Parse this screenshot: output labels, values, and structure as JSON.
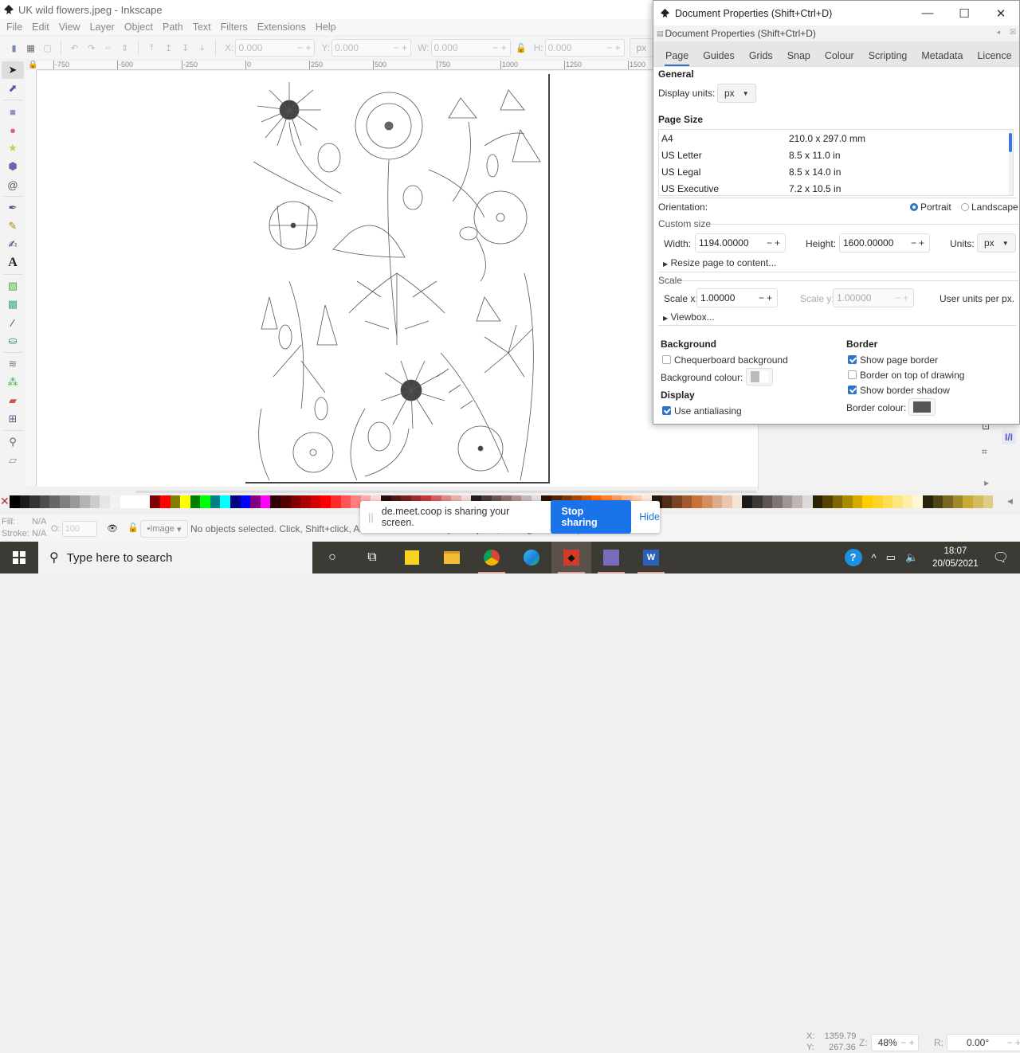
{
  "app": {
    "window_title": "UK wild flowers.jpeg - Inkscape",
    "menu": [
      "File",
      "Edit",
      "View",
      "Layer",
      "Object",
      "Path",
      "Text",
      "Filters",
      "Extensions",
      "Help"
    ],
    "toolbar": {
      "x_label": "X:",
      "x_value": "0.000",
      "y_label": "Y:",
      "y_value": "0.000",
      "w_label": "W:",
      "w_value": "0.000",
      "h_label": "H:",
      "h_value": "0.000",
      "units": "px"
    },
    "ruler_labels": [
      "-750",
      "-500",
      "-250",
      "0",
      "250",
      "500",
      "750",
      "1000",
      "1250",
      "1500"
    ],
    "tools": [
      "selector-tool",
      "node-tool",
      "rectangle-tool",
      "ellipse-tool",
      "star-tool",
      "3d-box-tool",
      "spiral-tool",
      "bezier-tool",
      "pencil-tool",
      "calligraphy-tool",
      "text-tool",
      "gradient-tool",
      "mesh-tool",
      "dropper-tool",
      "paint-bucket-tool",
      "tweak-tool",
      "spray-tool",
      "eraser-tool",
      "connector-tool",
      "zoom-tool",
      "measure-tool"
    ],
    "palette": [
      "#000000",
      "#1a1a1a",
      "#333333",
      "#4d4d4d",
      "#666666",
      "#808080",
      "#999999",
      "#b3b3b3",
      "#cccccc",
      "#e6e6e6",
      "#f2f2f2",
      "#ffffff",
      "#ffffff",
      "#ffffff",
      "#800000",
      "#ff0000",
      "#808000",
      "#ffff00",
      "#008000",
      "#00ff00",
      "#008080",
      "#00ffff",
      "#000080",
      "#0000ff",
      "#800080",
      "#ff00ff",
      "#2b0000",
      "#550000",
      "#800000",
      "#aa0000",
      "#d40000",
      "#ff0000",
      "#ff2a2a",
      "#ff5555",
      "#ff8080",
      "#ffaaaa",
      "#ffd5d5",
      "#280b0b",
      "#501616",
      "#782121",
      "#a02c2c",
      "#c83737",
      "#d35f5f",
      "#de8787",
      "#e9afaf",
      "#f4d7d7",
      "#241c1c",
      "#483737",
      "#6c5353",
      "#916f6f",
      "#ac9393",
      "#c8b7b7",
      "#e3dbdb",
      "#2b1100",
      "#552200",
      "#803300",
      "#aa4400",
      "#d45500",
      "#ff6600",
      "#ff7f2a",
      "#ff9955",
      "#ffb380",
      "#ffccaa",
      "#ffe6d5",
      "#28170b",
      "#502d16",
      "#784421",
      "#a05a2c",
      "#c87137",
      "#d38d5f",
      "#deaa87",
      "#e9c6af",
      "#f4e3d7",
      "#1c1a1a",
      "#3d3735",
      "#5e5552",
      "#7f7470",
      "#9f9593",
      "#bfb6b4",
      "#ded9d8",
      "#2b2200",
      "#554400",
      "#806600",
      "#aa8800",
      "#d4aa00",
      "#ffcc00",
      "#ffd42a",
      "#ffdd55",
      "#ffe680",
      "#ffeeaa",
      "#fff6d5",
      "#28220b",
      "#504416",
      "#786721",
      "#a0892c",
      "#c8ab37",
      "#d3bc5f",
      "#decd87"
    ],
    "status": {
      "fill_label": "Fill:",
      "fill_value": "N/A",
      "stroke_label": "Stroke:",
      "stroke_value": "N/A",
      "opacity_label": "O:",
      "opacity_value": "100",
      "layer": "•Image",
      "message": "No objects selected. Click, Shift+click, Alt+scroll mouse on top of objects, or drag around objects to select.",
      "cursor_x_label": "X:",
      "cursor_x": "1359.79",
      "cursor_y_label": "Y:",
      "cursor_y": "267.36",
      "zoom_label": "Z:",
      "zoom": "48%",
      "rotation_label": "R:",
      "rotation": "0.00°"
    }
  },
  "share_bar": {
    "message": "de.meet.coop is sharing your screen.",
    "stop_label": "Stop sharing",
    "hide_label": "Hide"
  },
  "dialog": {
    "title": "Document Properties (Shift+Ctrl+D)",
    "dock_title": "Document Properties (Shift+Ctrl+D)",
    "tabs": [
      "Page",
      "Guides",
      "Grids",
      "Snap",
      "Colour",
      "Scripting",
      "Metadata",
      "Licence"
    ],
    "active_tab": "Page",
    "general_heading": "General",
    "display_units_label": "Display units:",
    "display_units": "px",
    "page_size_heading": "Page Size",
    "page_sizes": [
      {
        "name": "A4",
        "size": "210.0 x 297.0 mm"
      },
      {
        "name": "US Letter",
        "size": "8.5 x 11.0 in"
      },
      {
        "name": "US Legal",
        "size": "8.5 x 14.0 in"
      },
      {
        "name": "US Executive",
        "size": "7.2 x 10.5 in"
      }
    ],
    "orientation_label": "Orientation:",
    "portrait_label": "Portrait",
    "landscape_label": "Landscape",
    "orientation": "Portrait",
    "custom_size_label": "Custom size",
    "width_label": "Width:",
    "width_value": "1194.00000",
    "height_label": "Height:",
    "height_value": "1600.00000",
    "units_label": "Units:",
    "units_value": "px",
    "resize_label": "Resize page to content...",
    "scale_label": "Scale",
    "scale_x_label": "Scale x:",
    "scale_x": "1.00000",
    "scale_y_label": "Scale y:",
    "scale_y": "1.00000",
    "user_units_label": "User units per px.",
    "viewbox_label": "Viewbox...",
    "background_heading": "Background",
    "chequerboard_label": "Chequerboard background",
    "chequerboard": false,
    "bg_colour_label": "Background colour:",
    "display_heading": "Display",
    "antialias_label": "Use antialiasing",
    "antialias": true,
    "border_heading": "Border",
    "show_border_label": "Show page border",
    "show_border": true,
    "border_on_top_label": "Border on top of drawing",
    "border_on_top": false,
    "border_shadow_label": "Show border shadow",
    "border_shadow": true,
    "border_colour_label": "Border colour:",
    "border_colour": "#555555"
  },
  "taskbar": {
    "search_placeholder": "Type here to search",
    "time": "18:07",
    "date": "20/05/2021"
  }
}
